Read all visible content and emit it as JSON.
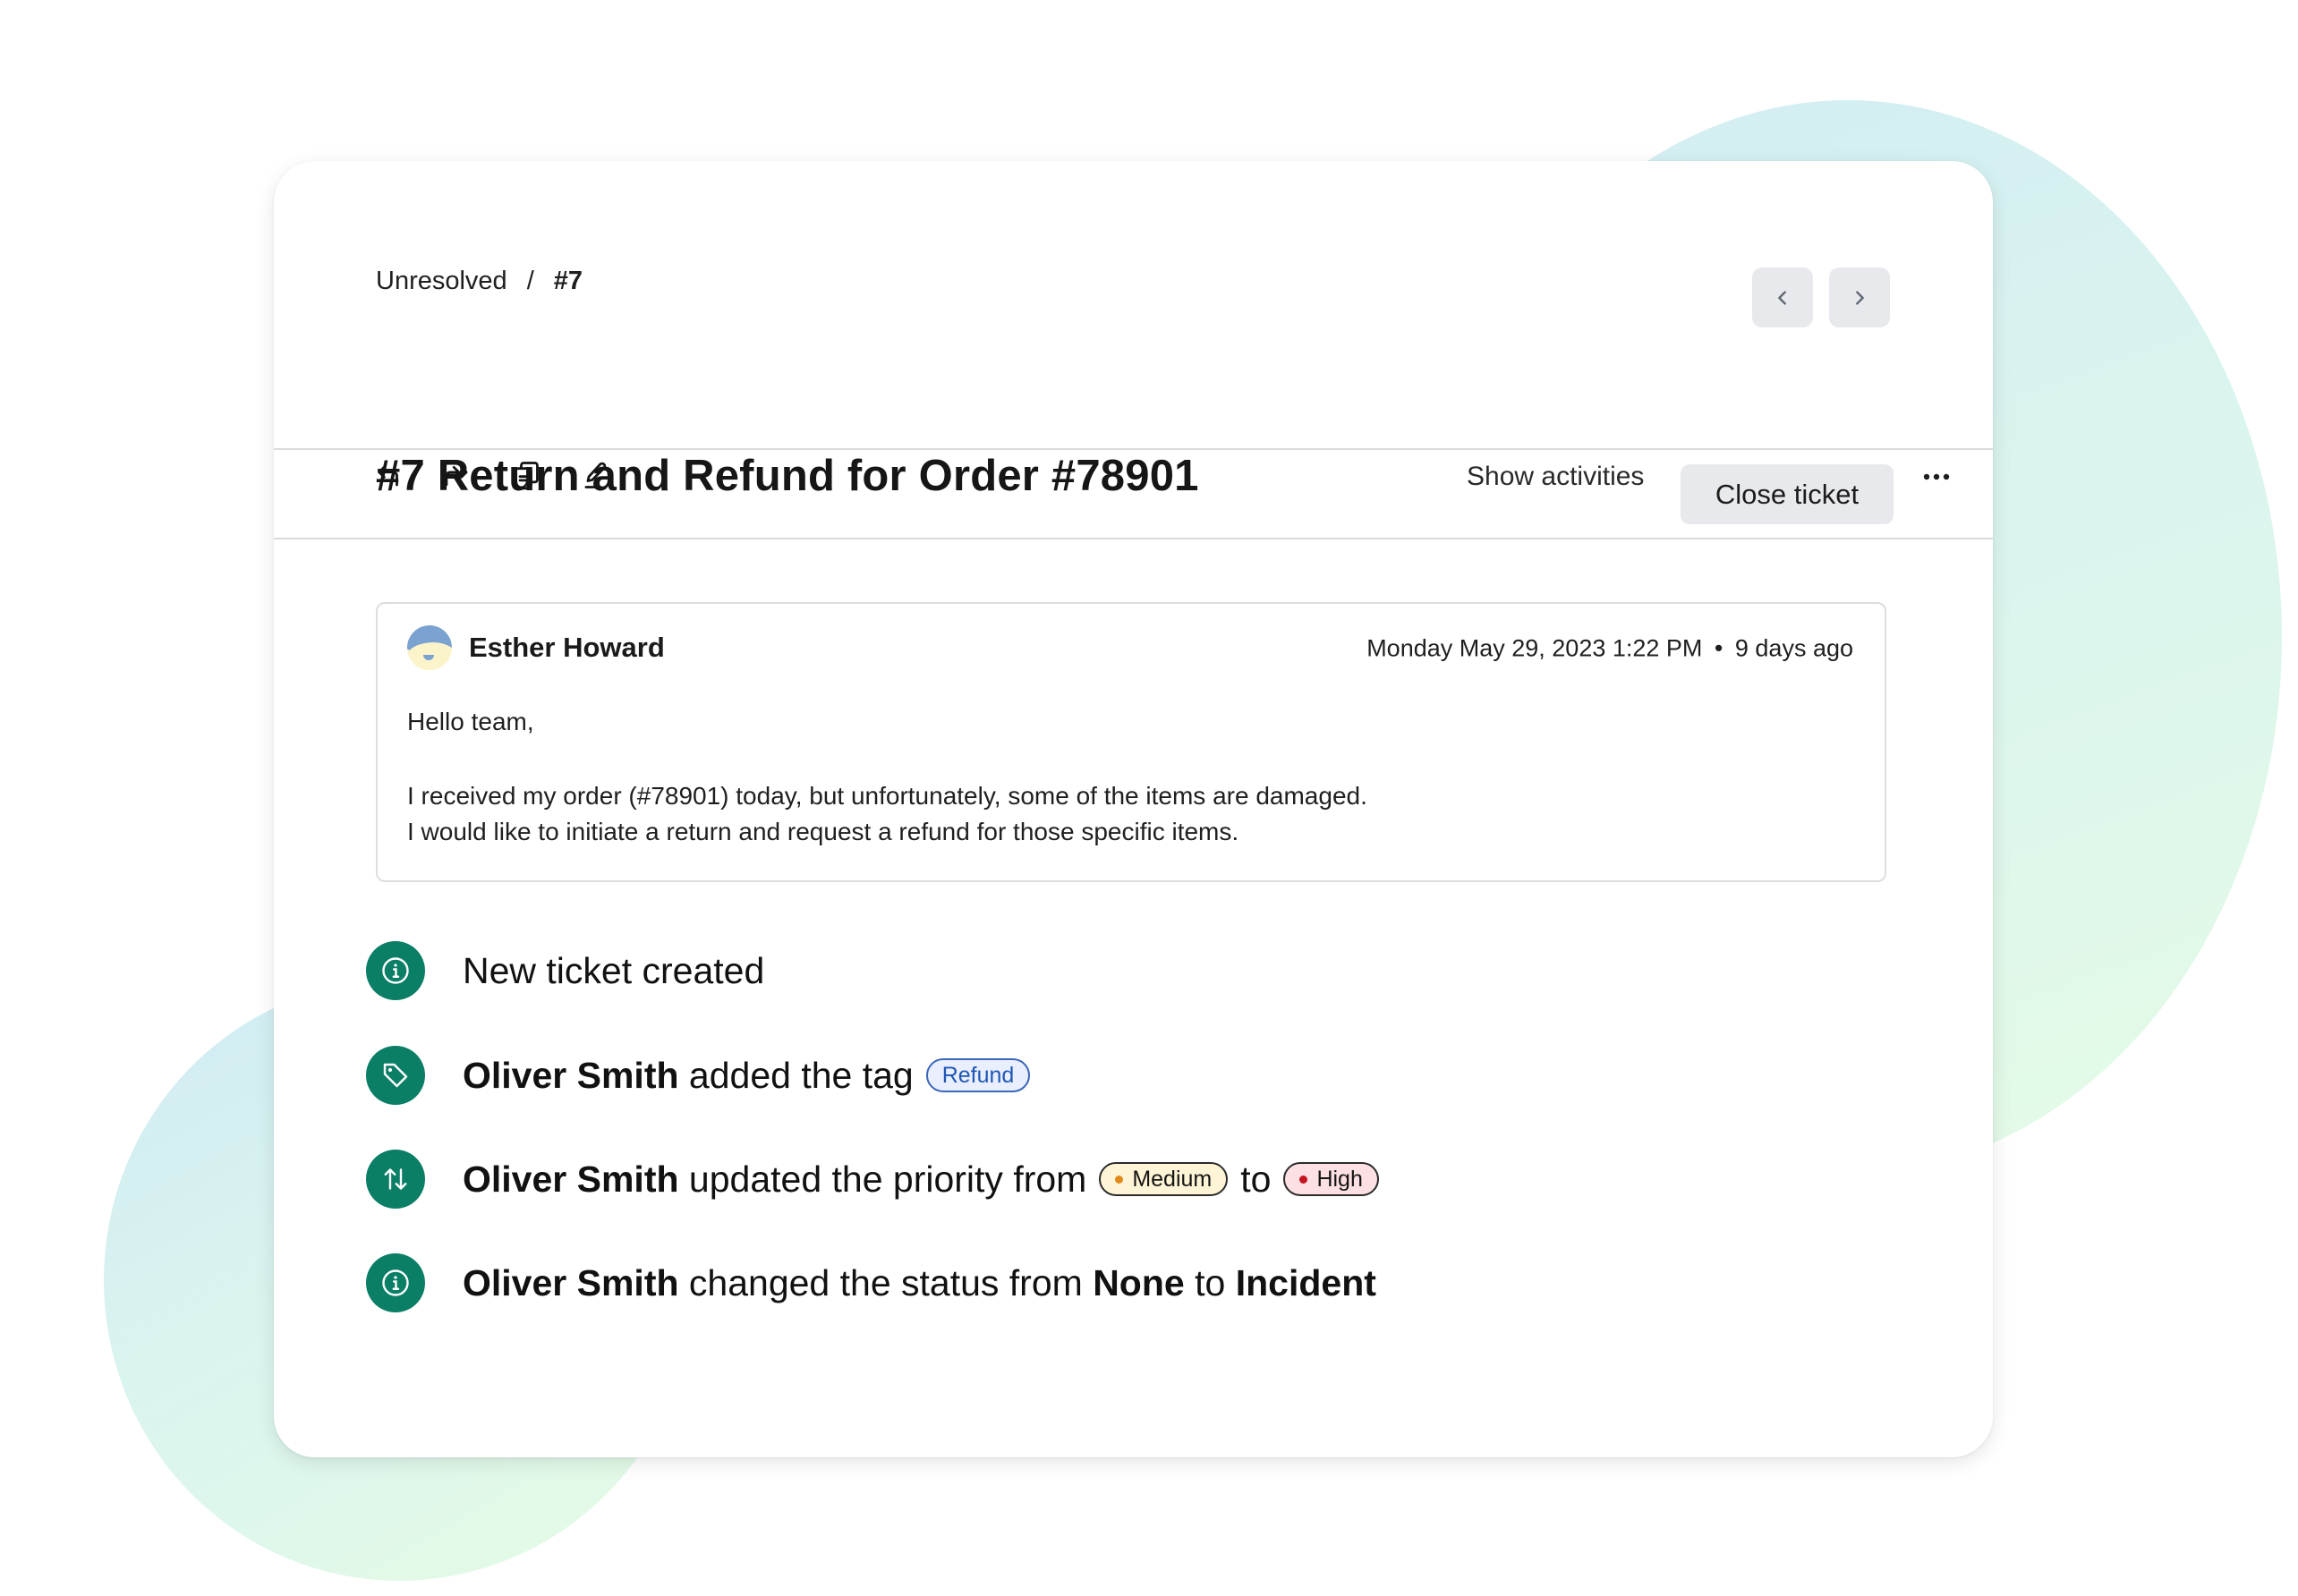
{
  "breadcrumb": {
    "parent": "Unresolved",
    "separator": "/",
    "current": "#7"
  },
  "ticket": {
    "title": "#7 Return and Refund for Order #78901"
  },
  "nav": {
    "prev_icon": "chevron-left-icon",
    "next_icon": "chevron-right-icon"
  },
  "toolbar": {
    "icons": [
      "reply-icon",
      "forward-all-icon",
      "copy-icon",
      "edit-icon"
    ],
    "show_activities_label": "Show activities",
    "close_ticket_label": "Close ticket",
    "more_icon": "more-horizontal-icon"
  },
  "message": {
    "author": "Esther Howard",
    "timestamp": "Monday May 29, 2023 1:22 PM",
    "relative_time": "9 days ago",
    "separator": "•",
    "greeting": "Hello team,",
    "lines": [
      "I received my order (#78901) today, but unfortunately, some of the items are damaged.",
      "I would like to initiate a return and request a refund for those specific items."
    ]
  },
  "activities": [
    {
      "icon": "info-icon",
      "text": "New ticket created"
    },
    {
      "icon": "tag-icon",
      "actor": "Oliver Smith",
      "text": "added the tag",
      "tag": "Refund"
    },
    {
      "icon": "sort-arrows-icon",
      "actor": "Oliver Smith",
      "text": "updated the priority from",
      "from": "Medium",
      "connector": "to",
      "to": "High"
    },
    {
      "icon": "info-icon",
      "actor": "Oliver Smith",
      "text": "changed the status from",
      "from": "None",
      "connector": "to",
      "to": "Incident"
    }
  ],
  "colors": {
    "activity_icon_bg": "#0b7e66",
    "tag_text": "#1f57b5",
    "tag_bg": "#e9efff",
    "medium_dot": "#e08a1e",
    "medium_bg": "#fff5d6",
    "high_dot": "#c4141f",
    "high_bg": "#fde0e3",
    "button_bg": "#e8e9ec"
  }
}
